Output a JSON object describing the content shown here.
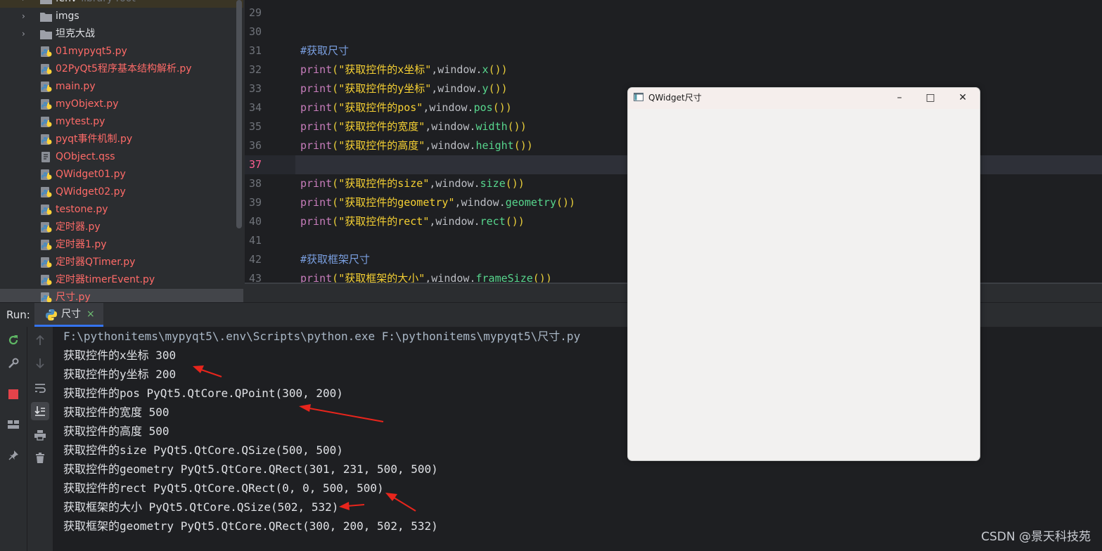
{
  "project_tree": [
    {
      "type": "folder",
      "label": ".env",
      "sub": "library root",
      "arrow": "›",
      "cut_top": true
    },
    {
      "type": "folder",
      "label": "imgs",
      "arrow": "›"
    },
    {
      "type": "folder",
      "label": "坦克大战",
      "arrow": "›"
    },
    {
      "type": "py",
      "label": "01mypyqt5.py"
    },
    {
      "type": "py",
      "label": "02PyQt5程序基本结构解析.py"
    },
    {
      "type": "py",
      "label": "main.py"
    },
    {
      "type": "py",
      "label": "myObjext.py"
    },
    {
      "type": "py",
      "label": "mytest.py"
    },
    {
      "type": "py",
      "label": "pyqt事件机制.py"
    },
    {
      "type": "qss",
      "label": "QObject.qss"
    },
    {
      "type": "py",
      "label": "QWidget01.py"
    },
    {
      "type": "py",
      "label": "QWidget02.py"
    },
    {
      "type": "py",
      "label": "testone.py"
    },
    {
      "type": "py",
      "label": "定时器.py"
    },
    {
      "type": "py",
      "label": "定时器1.py"
    },
    {
      "type": "py",
      "label": "定时器QTimer.py"
    },
    {
      "type": "py",
      "label": "定时器timerEvent.py"
    },
    {
      "type": "py",
      "label": "尺寸.py",
      "selected": true
    }
  ],
  "editor": {
    "current_line": "37",
    "lines": [
      {
        "num": "29",
        "kind": "blank"
      },
      {
        "num": "30",
        "kind": "blank"
      },
      {
        "num": "31",
        "kind": "comment",
        "text": "#获取尺寸"
      },
      {
        "num": "32",
        "kind": "print",
        "str": "\"获取控件的x坐标\"",
        "method": "x"
      },
      {
        "num": "33",
        "kind": "print",
        "str": "\"获取控件的y坐标\"",
        "method": "y"
      },
      {
        "num": "34",
        "kind": "print",
        "str": "\"获取控件的pos\"",
        "method": "pos"
      },
      {
        "num": "35",
        "kind": "print",
        "str": "\"获取控件的宽度\"",
        "method": "width"
      },
      {
        "num": "36",
        "kind": "print",
        "str": "\"获取控件的高度\"",
        "method": "height"
      },
      {
        "num": "37",
        "kind": "blank"
      },
      {
        "num": "38",
        "kind": "print",
        "str": "\"获取控件的size\"",
        "method": "size"
      },
      {
        "num": "39",
        "kind": "print",
        "str": "\"获取控件的geometry\"",
        "method": "geometry"
      },
      {
        "num": "40",
        "kind": "print",
        "str": "\"获取控件的rect\"",
        "method": "rect"
      },
      {
        "num": "41",
        "kind": "blank"
      },
      {
        "num": "42",
        "kind": "comment",
        "text": "#获取框架尺寸"
      },
      {
        "num": "43",
        "kind": "print",
        "str": "\"获取框架的大小\"",
        "method": "frameSize"
      }
    ]
  },
  "run_panel": {
    "title": "Run:",
    "tab_label": "尺寸",
    "tab_close": "×"
  },
  "console": {
    "command": "F:\\pythonitems\\mypyqt5\\.env\\Scripts\\python.exe F:\\pythonitems\\mypyqt5\\尺寸.py",
    "output": [
      "获取控件的x坐标 300",
      "获取控件的y坐标 200",
      "获取控件的pos PyQt5.QtCore.QPoint(300, 200)",
      "获取控件的宽度 500",
      "获取控件的高度 500",
      "获取控件的size PyQt5.QtCore.QSize(500, 500)",
      "获取控件的geometry PyQt5.QtCore.QRect(301, 231, 500, 500)",
      "获取控件的rect PyQt5.QtCore.QRect(0, 0, 500, 500)",
      "获取框架的大小 PyQt5.QtCore.QSize(502, 532)",
      "获取框架的geometry PyQt5.QtCore.QRect(300, 200, 502, 532)"
    ]
  },
  "qt_window": {
    "title": "QWidget尺寸",
    "minimize": "–",
    "maximize": "□",
    "close": "✕"
  },
  "colors": {
    "annotation_arrow": "#e8251c",
    "editor_bg": "#1e1f22",
    "panel_bg": "#2b2d30",
    "modified_file": "#ff6b68"
  },
  "watermark": "CSDN @景天科技苑"
}
